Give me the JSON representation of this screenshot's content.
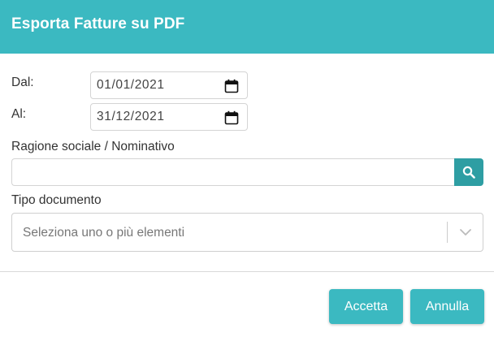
{
  "dialog": {
    "title": "Esporta Fatture su PDF"
  },
  "form": {
    "from_label": "Dal:",
    "from_value": "01/01/2021",
    "to_label": "Al:",
    "to_value": "31/12/2021",
    "company_label": "Ragione sociale / Nominativo",
    "company_value": "",
    "doctype_label": "Tipo documento",
    "doctype_placeholder": "Seleziona uno o più elementi"
  },
  "buttons": {
    "accept": "Accetta",
    "cancel": "Annulla"
  },
  "icons": {
    "calendar": "calendar-icon",
    "search": "search-icon",
    "chevron": "chevron-down-icon"
  },
  "colors": {
    "header": "#3bb9c1",
    "button": "#3bb9c1",
    "search_button": "#2e9ea3"
  }
}
